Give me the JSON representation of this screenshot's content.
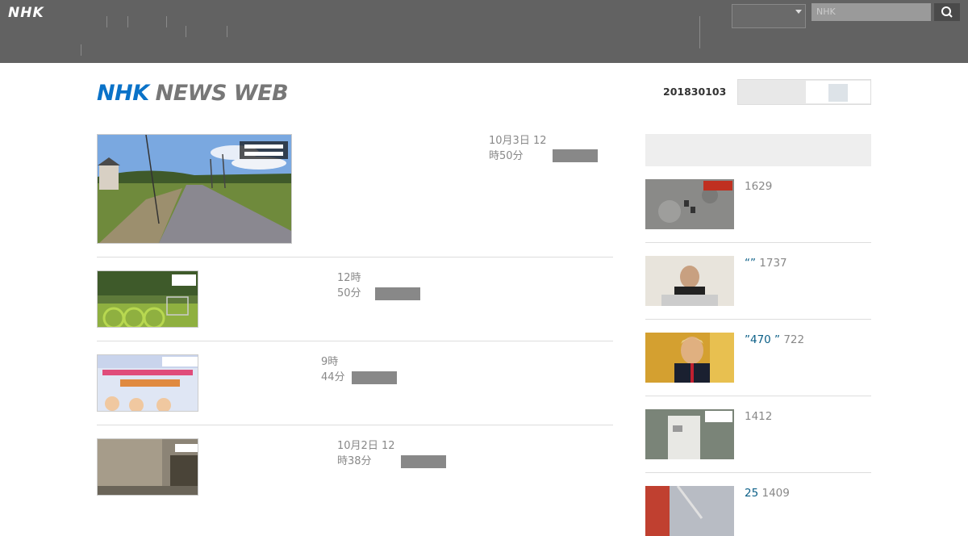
{
  "topbar": {
    "logo": "NHK",
    "nav": [
      {
        "l1": "",
        "l2": "",
        "l3": ""
      },
      {
        "l1": "",
        "l2": "",
        "l3": ""
      },
      {
        "l1": "",
        "l2": "",
        "l3": ""
      },
      {
        "l1": "",
        "l2": "",
        "l3": ""
      },
      {
        "l1": "",
        "l2": "",
        "l3": ""
      },
      {
        "l1": "",
        "l2": "",
        "l3": ""
      }
    ],
    "right_nav": [
      {
        "l1": "",
        "l2": ""
      },
      {
        "l1": "",
        "l2": ""
      }
    ],
    "select_value": "",
    "search_placeholder": "NHK"
  },
  "header": {
    "brand_nhk": "NHK",
    "brand_news": "NEWS WEB",
    "date": "201830103",
    "toggle_label": ""
  },
  "articles": [
    {
      "title": "",
      "date": "10月3日 12",
      "time": "時50分"
    },
    {
      "title": "",
      "date": "12時",
      "time": "50分"
    },
    {
      "title": "",
      "date": "9時",
      "time": "44分"
    },
    {
      "title": "",
      "date": "10月2日 12",
      "time": "時38分"
    }
  ],
  "ranking": {
    "title": "",
    "items": [
      {
        "text": "",
        "count": "1629"
      },
      {
        "text": " “” ",
        "count": "1737"
      },
      {
        "text": "”470 ” ",
        "count": "722"
      },
      {
        "text": " ",
        "count": "1412"
      },
      {
        "text": "25 ",
        "count": "1409"
      }
    ]
  },
  "colors": {
    "accent": "#0b5f87",
    "brand_blue": "#0a72c8",
    "topbar": "#626262"
  }
}
